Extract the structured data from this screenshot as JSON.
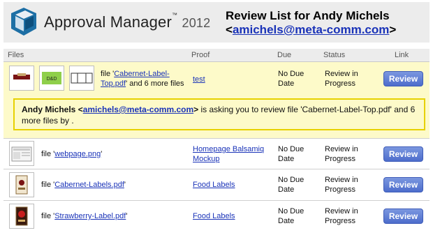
{
  "header": {
    "app_name": "Approval Manager",
    "trademark": "™",
    "year": "2012",
    "review_prefix": "Review List for Andy Michels",
    "email_open": "<",
    "email": "amichels@meta-comm.com",
    "email_close": ">"
  },
  "columns": {
    "files": "Files",
    "proof": "Proof",
    "due": "Due",
    "status": "Status",
    "link": "Link"
  },
  "rows": [
    {
      "file_prefix": "file '",
      "file_name": "Cabernet-Label-Top.pdf",
      "file_suffix": "' and 6 more files",
      "proof": "test",
      "due": "No Due Date",
      "status": "Review in Progress",
      "button": "Review"
    },
    {
      "file_prefix": "file '",
      "file_name": "webpage.png",
      "file_suffix": "'",
      "proof": "Homepage Balsamiq Mockup",
      "due": "No Due Date",
      "status": "Review in Progress",
      "button": "Review"
    },
    {
      "file_prefix": "file '",
      "file_name": "Cabernet-Labels.pdf",
      "file_suffix": "'",
      "proof": "Food Labels",
      "due": "No Due Date",
      "status": "Review in Progress",
      "button": "Review"
    },
    {
      "file_prefix": "file '",
      "file_name": "Strawberry-Label.pdf",
      "file_suffix": "'",
      "proof": "Food Labels",
      "due": "No Due Date",
      "status": "Review in Progress",
      "button": "Review"
    }
  ],
  "message": {
    "name": "Andy Michels",
    "email_open": " <",
    "email": "amichels@meta-comm.com",
    "email_close": ">",
    "text": " is asking you to review file 'Cabernet-Label-Top.pdf' and 6 more files by ."
  },
  "colors": {
    "accent": "#1a33b8",
    "highlight": "#fdfac9",
    "button": "#5a78d4",
    "border": "#e7d100"
  }
}
